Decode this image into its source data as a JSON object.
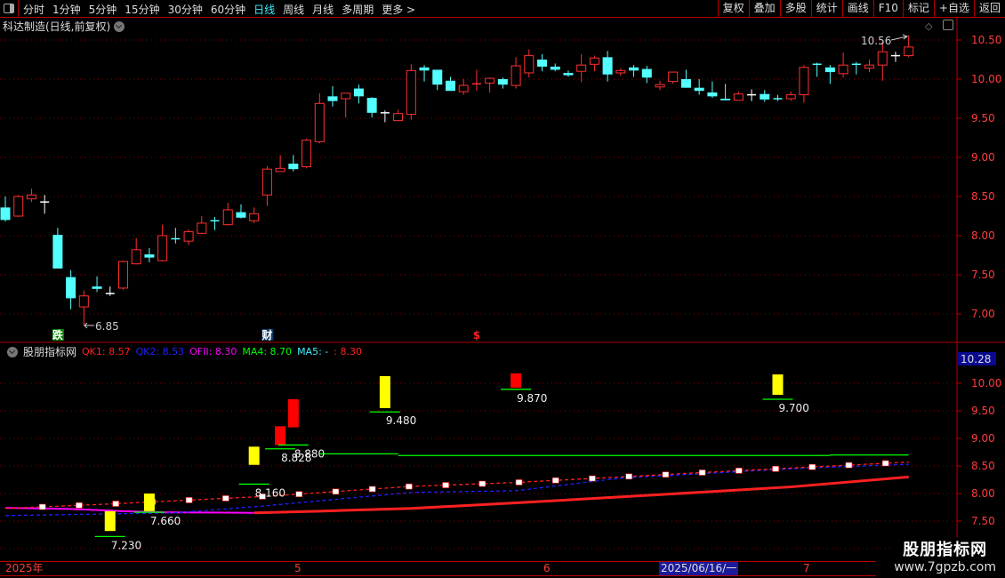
{
  "toolbar": {
    "periods": [
      "分时",
      "1分钟",
      "5分钟",
      "15分钟",
      "30分钟",
      "60分钟",
      "日线",
      "周线",
      "月线",
      "多周期",
      "更多 >"
    ],
    "active_period": "日线",
    "buttons": [
      "复权",
      "叠加",
      "多股",
      "统计",
      "画线",
      "F10",
      "标记",
      "+自选",
      "返回"
    ]
  },
  "chart_title": "科达制造(日线,前复权)",
  "colors": {
    "up": "#ff3030",
    "down": "#54ffff",
    "cross": "#ffffff",
    "grid": "#8b0000",
    "axis_text": "#ff3b3b",
    "qk1": "#ff2020",
    "qk2": "#2020ff",
    "ofii": "#ff00ff",
    "ma4": "#00ff00",
    "ma5": "#3ef0ff",
    "signal_yellow": "#ffff00",
    "signal_red": "#ff0000"
  },
  "price_axis": {
    "ticks": [
      "10.50",
      "10.00",
      "9.50",
      "9.00",
      "8.50",
      "8.00",
      "7.50",
      "7.00"
    ],
    "range": [
      6.7,
      10.7
    ]
  },
  "price_annotations": {
    "high": "10.56",
    "low": "6.85"
  },
  "candles": [
    [
      8.36,
      8.5,
      8.18,
      8.2
    ],
    [
      8.25,
      8.52,
      8.24,
      8.5
    ],
    [
      8.47,
      8.6,
      8.43,
      8.52
    ],
    [
      8.43,
      8.52,
      8.28,
      8.43
    ],
    [
      8.01,
      8.1,
      7.58,
      7.58
    ],
    [
      7.47,
      7.56,
      7.06,
      7.2
    ],
    [
      7.09,
      7.3,
      6.85,
      7.23
    ],
    [
      7.35,
      7.48,
      7.28,
      7.32
    ],
    [
      7.26,
      7.35,
      7.23,
      7.26
    ],
    [
      7.33,
      7.68,
      7.31,
      7.67
    ],
    [
      7.64,
      7.97,
      7.63,
      7.82
    ],
    [
      7.76,
      7.84,
      7.66,
      7.72
    ],
    [
      7.68,
      8.14,
      7.67,
      8.0
    ],
    [
      7.96,
      8.1,
      7.9,
      7.95
    ],
    [
      7.93,
      8.08,
      7.88,
      8.05
    ],
    [
      8.03,
      8.25,
      8.02,
      8.16
    ],
    [
      8.19,
      8.24,
      8.07,
      8.18
    ],
    [
      8.14,
      8.42,
      8.13,
      8.33
    ],
    [
      8.3,
      8.4,
      8.22,
      8.23
    ],
    [
      8.19,
      8.36,
      8.16,
      8.28
    ],
    [
      8.52,
      8.89,
      8.38,
      8.85
    ],
    [
      8.82,
      9.03,
      8.82,
      8.86
    ],
    [
      8.92,
      9.03,
      8.82,
      8.85
    ],
    [
      8.88,
      9.24,
      8.86,
      9.22
    ],
    [
      9.2,
      9.82,
      9.18,
      9.69
    ],
    [
      9.78,
      9.91,
      9.65,
      9.72
    ],
    [
      9.75,
      9.82,
      9.51,
      9.82
    ],
    [
      9.88,
      9.93,
      9.69,
      9.78
    ],
    [
      9.76,
      9.77,
      9.51,
      9.57
    ],
    [
      9.57,
      9.6,
      9.45,
      9.57
    ],
    [
      9.47,
      9.61,
      9.47,
      9.56
    ],
    [
      9.55,
      10.19,
      9.48,
      10.11
    ],
    [
      10.15,
      10.18,
      9.97,
      10.11
    ],
    [
      10.12,
      10.12,
      9.86,
      9.93
    ],
    [
      9.98,
      10.03,
      9.85,
      9.85
    ],
    [
      9.84,
      10.0,
      9.8,
      9.92
    ],
    [
      9.93,
      10.12,
      9.85,
      9.94
    ],
    [
      9.95,
      10.02,
      9.83,
      10.01
    ],
    [
      10.0,
      10.02,
      9.88,
      9.93
    ],
    [
      9.92,
      10.28,
      9.88,
      10.17
    ],
    [
      10.08,
      10.38,
      10.02,
      10.3
    ],
    [
      10.25,
      10.32,
      10.1,
      10.16
    ],
    [
      10.16,
      10.2,
      10.1,
      10.12
    ],
    [
      10.08,
      10.11,
      10.03,
      10.05
    ],
    [
      10.1,
      10.32,
      9.96,
      10.18
    ],
    [
      10.19,
      10.3,
      10.1,
      10.27
    ],
    [
      10.28,
      10.36,
      9.97,
      10.06
    ],
    [
      10.08,
      10.14,
      10.04,
      10.11
    ],
    [
      10.15,
      10.18,
      10.03,
      10.11
    ],
    [
      10.13,
      10.17,
      9.95,
      10.02
    ],
    [
      9.9,
      9.98,
      9.86,
      9.93
    ],
    [
      9.97,
      10.09,
      9.94,
      10.09
    ],
    [
      10.0,
      10.12,
      9.89,
      9.89
    ],
    [
      9.89,
      10.0,
      9.8,
      9.85
    ],
    [
      9.83,
      9.97,
      9.76,
      9.78
    ],
    [
      9.75,
      9.94,
      9.73,
      9.73
    ],
    [
      9.73,
      9.84,
      9.73,
      9.81
    ],
    [
      9.8,
      9.87,
      9.72,
      9.8
    ],
    [
      9.81,
      9.86,
      9.71,
      9.74
    ],
    [
      9.75,
      9.8,
      9.72,
      9.74
    ],
    [
      9.75,
      9.84,
      9.72,
      9.8
    ],
    [
      9.8,
      10.18,
      9.7,
      10.15
    ],
    [
      10.19,
      10.21,
      10.03,
      10.18
    ],
    [
      10.15,
      10.18,
      9.94,
      10.09
    ],
    [
      10.07,
      10.34,
      10.02,
      10.18
    ],
    [
      10.19,
      10.22,
      10.06,
      10.18
    ],
    [
      10.14,
      10.25,
      10.09,
      10.18
    ],
    [
      10.18,
      10.48,
      9.98,
      10.35
    ],
    [
      10.3,
      10.35,
      10.22,
      10.3
    ],
    [
      10.3,
      10.56,
      10.28,
      10.41
    ]
  ],
  "event_markers": [
    {
      "label": "跌",
      "index": 4,
      "bg": "#008000",
      "fg": "#ffffff"
    },
    {
      "label": "财",
      "index": 20,
      "bg": "#0a3a6a",
      "fg": "#ffffff"
    },
    {
      "label": "$",
      "index": 36,
      "bg": "",
      "fg": "#ff2020"
    }
  ],
  "indicator": {
    "name": "股朋指标网",
    "legend": [
      {
        "label": "QK1: 8.57",
        "color": "#ff2020"
      },
      {
        "label": "QK2: 8.53",
        "color": "#2020ff"
      },
      {
        "label": "OFII: 8.30",
        "color": "#ff00ff"
      },
      {
        "label": "MA4: 8.70",
        "color": "#00ff00"
      },
      {
        "label": "MA5: -",
        "color": "#3ef0ff"
      },
      {
        "label": ": 8.30",
        "color": "#ff2020"
      }
    ],
    "axis_ticks": [
      "10.00",
      "9.50",
      "9.00",
      "8.50",
      "8.00",
      "7.50"
    ],
    "range": [
      6.95,
      10.5
    ],
    "current_value": "10.28",
    "qk1": [
      [
        0,
        7.73
      ],
      [
        8,
        7.81
      ],
      [
        20,
        7.95
      ],
      [
        31,
        8.13
      ],
      [
        39,
        8.2
      ],
      [
        54,
        8.39
      ],
      [
        69,
        8.57
      ]
    ],
    "qk2": [
      [
        0,
        7.6
      ],
      [
        13,
        7.65
      ],
      [
        20,
        7.78
      ],
      [
        31,
        8.02
      ],
      [
        39,
        8.05
      ],
      [
        47,
        8.28
      ],
      [
        61,
        8.46
      ],
      [
        69,
        8.53
      ]
    ],
    "ofii_flat": [
      [
        0,
        7.74
      ],
      [
        5,
        7.72
      ],
      [
        9,
        7.68
      ],
      [
        12,
        7.66
      ],
      [
        19,
        7.65
      ]
    ],
    "ofii_rise": [
      [
        19,
        7.65
      ],
      [
        24,
        7.68
      ],
      [
        31,
        7.73
      ],
      [
        39,
        7.83
      ],
      [
        50,
        7.98
      ],
      [
        60,
        8.12
      ],
      [
        69,
        8.3
      ]
    ],
    "ma4": [
      [
        [
          24,
          8.72
        ],
        [
          30,
          8.72
        ]
      ],
      [
        [
          30,
          8.69
        ],
        [
          63,
          8.69
        ]
      ],
      [
        [
          63,
          8.7
        ],
        [
          69,
          8.7
        ]
      ]
    ],
    "signals": [
      {
        "index": 8,
        "top": 7.68,
        "bottom": 7.32,
        "color": "yellow",
        "level": 7.22,
        "label": "7.230"
      },
      {
        "index": 11,
        "top": 8.0,
        "bottom": 7.68,
        "color": "yellow",
        "level": 7.66,
        "label": "7.660"
      },
      {
        "index": 19,
        "top": 8.85,
        "bottom": 8.52,
        "color": "yellow",
        "level": 8.17,
        "label": "8.160"
      },
      {
        "index": 21,
        "top": 9.22,
        "bottom": 8.88,
        "color": "red",
        "level": 8.81,
        "label": "8.828"
      },
      {
        "index": 22,
        "top": 9.71,
        "bottom": 9.2,
        "color": "red",
        "level": 8.88,
        "label": "8.880"
      },
      {
        "index": 29,
        "top": 10.13,
        "bottom": 9.55,
        "color": "yellow",
        "level": 9.48,
        "label": "9.480"
      },
      {
        "index": 39,
        "top": 10.18,
        "bottom": 9.92,
        "color": "red",
        "level": 9.89,
        "label": "9.870"
      },
      {
        "index": 59,
        "top": 10.16,
        "bottom": 9.79,
        "color": "yellow",
        "level": 9.71,
        "label": "9.700"
      }
    ]
  },
  "date_axis": [
    {
      "label": "2025年",
      "highlight": false
    },
    {
      "label": "5",
      "highlight": false
    },
    {
      "label": "6",
      "highlight": false
    },
    {
      "label": "2025/06/16/一",
      "highlight": true
    },
    {
      "label": "7",
      "highlight": false
    }
  ],
  "watermark": {
    "name": "股朋指标网",
    "url": "www.7gpzb.com"
  }
}
